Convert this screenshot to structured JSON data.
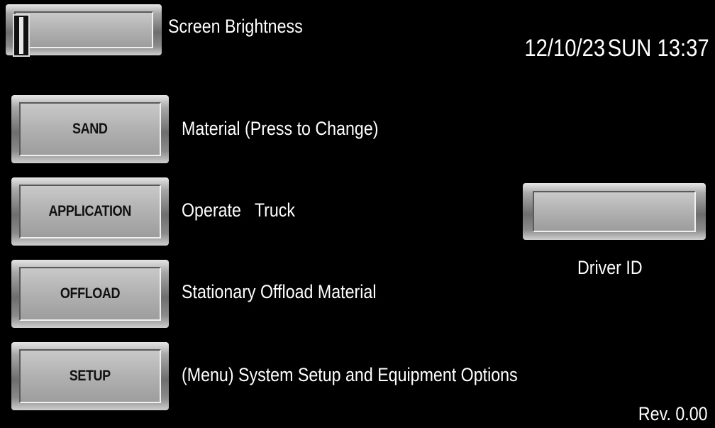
{
  "brightness": {
    "label": "Screen Brightness",
    "level": 0.0
  },
  "datetime": {
    "date": "12/10/23",
    "day": "SUN",
    "time": "13:37"
  },
  "menu": {
    "sand": {
      "button": "SAND",
      "description": "Material (Press to Change)"
    },
    "application": {
      "button": "APPLICATION",
      "description": "Operate   Truck"
    },
    "offload": {
      "button": "OFFLOAD",
      "description": "Stationary Offload Material"
    },
    "setup": {
      "button": "SETUP",
      "description": "(Menu) System Setup and Equipment Options"
    }
  },
  "driver": {
    "button_value": "",
    "label": "Driver ID"
  },
  "revision": "Rev. 0.00",
  "colors": {
    "background": "#000000",
    "text": "#ffffff",
    "button_face": "#b3b3b3",
    "button_text": "#111111"
  }
}
